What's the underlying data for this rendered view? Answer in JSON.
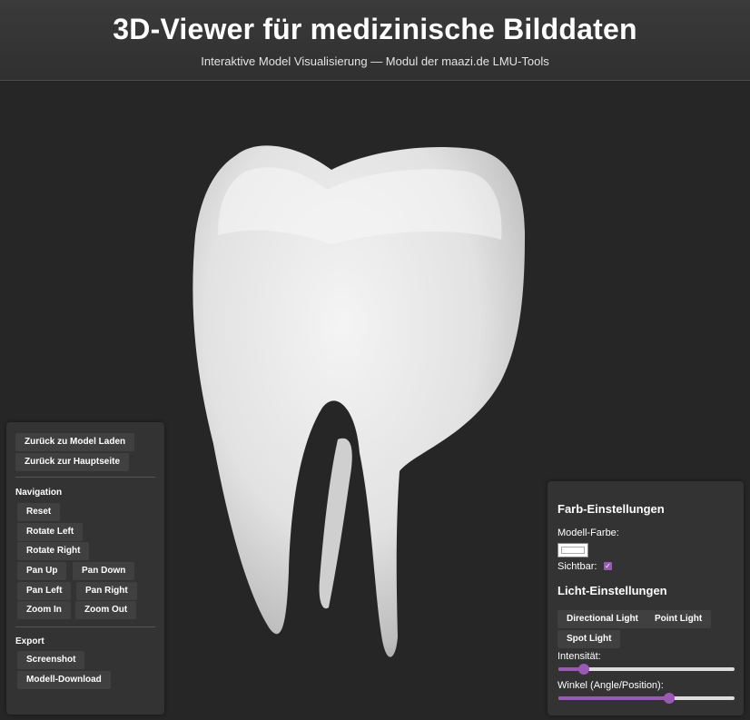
{
  "header": {
    "title": "3D-Viewer für medizinische Bilddaten",
    "subtitle": "Interaktive Model Visualisierung — Modul der maazi.de LMU-Tools"
  },
  "viewer": {
    "model_icon": "tooth-model"
  },
  "nav_panel": {
    "back_model_load": "Zurück zu Model Laden",
    "back_main": "Zurück zur Hauptseite",
    "navigation_title": "Navigation",
    "reset": "Reset",
    "rotate_left": "Rotate Left",
    "rotate_right": "Rotate Right",
    "pan_up": "Pan Up",
    "pan_down": "Pan Down",
    "pan_left": "Pan Left",
    "pan_right": "Pan Right",
    "zoom_in": "Zoom In",
    "zoom_out": "Zoom Out",
    "export_title": "Export",
    "screenshot": "Screenshot",
    "model_download": "Modell-Download"
  },
  "settings_panel": {
    "color_title": "Farb-Einstellungen",
    "model_color_label": "Modell-Farbe:",
    "model_color_value": "#ffffff",
    "visible_label": "Sichtbar:",
    "visible_checked": true,
    "light_title": "Licht-Einstellungen",
    "directional_light": "Directional Light",
    "point_light": "Point Light",
    "spot_light": "Spot Light",
    "intensity_label": "Intensität:",
    "intensity_fraction": 0.12,
    "angle_label": "Winkel (Angle/Position):",
    "angle_fraction": 0.64,
    "accent_color": "#9b59b6"
  }
}
